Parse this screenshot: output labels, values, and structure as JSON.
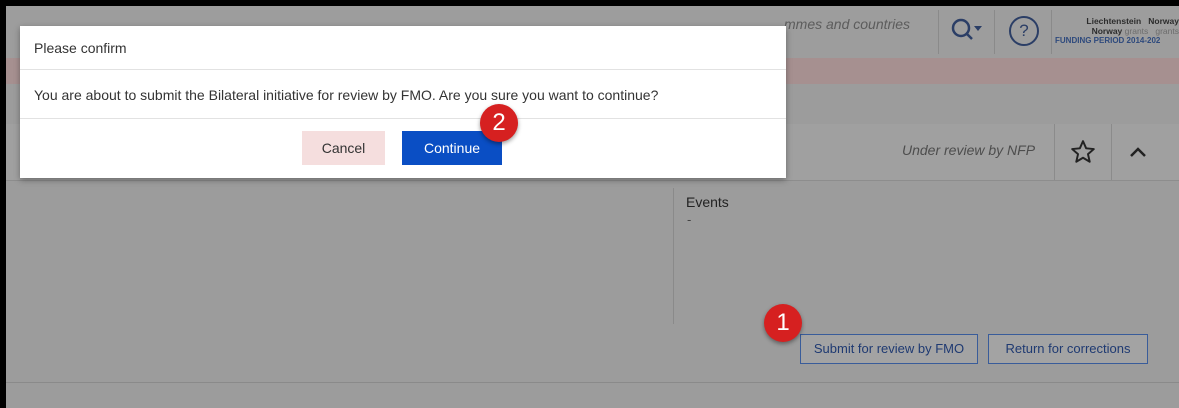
{
  "header": {
    "search_text": "mmes and countries",
    "logo": {
      "liechtenstein": "Liechtenstein",
      "norway": "Norway",
      "norway_grants": "Norway",
      "grants1": "grants",
      "grants2": "grants",
      "funding_period": "FUNDING PERIOD 2014-202"
    }
  },
  "card": {
    "status": "Under review by NFP",
    "events_label": "Events",
    "events_value": "-"
  },
  "actions": {
    "submit_label": "Submit for review by FMO",
    "return_label": "Return for corrections"
  },
  "modal": {
    "title": "Please confirm",
    "message": "You are about to submit the Bilateral initiative for review by FMO. Are you sure you want to continue?",
    "cancel_label": "Cancel",
    "continue_label": "Continue"
  },
  "markers": {
    "step1": "1",
    "step2": "2"
  },
  "colors": {
    "primary": "#0a4ec4",
    "cancel_bg": "#f5dede",
    "marker": "#d62020",
    "overlay": "#9b9b9b"
  },
  "icons": [
    "search-icon",
    "help-icon",
    "star-icon",
    "chevron-up-icon"
  ]
}
